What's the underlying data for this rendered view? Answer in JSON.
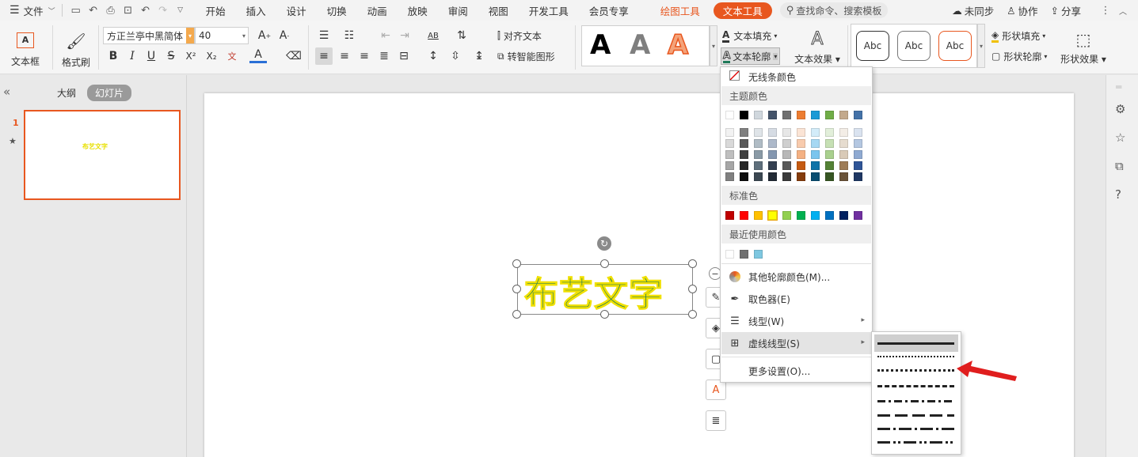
{
  "menubar": {
    "file_label": "文件",
    "tabs": [
      "开始",
      "插入",
      "设计",
      "切换",
      "动画",
      "放映",
      "审阅",
      "视图",
      "开发工具",
      "会员专享"
    ],
    "drawing_tools": "绘图工具",
    "text_tools": "文本工具",
    "search": "查找命令、搜索模板",
    "sync": "未同步",
    "collab": "协作",
    "share": "分享"
  },
  "ribbon": {
    "textbox": "文本框",
    "format_painter": "格式刷",
    "font_name": "方正兰亭中黑简体",
    "font_size": "40",
    "align_text": "对齐文本",
    "smart_shape": "转智能图形",
    "text_fill": "文本填充",
    "text_outline": "文本轮廓",
    "text_effect": "文本效果",
    "shape_fill": "形状填充",
    "shape_outline": "形状轮廓",
    "shape_effect": "形状效果",
    "style_sample": "A",
    "abc": [
      "Abc",
      "Abc",
      "Abc"
    ],
    "bold": "B",
    "italic": "I",
    "underline": "U",
    "strike": "S",
    "superscript": "X²",
    "subscript": "X₂",
    "font_color": "A",
    "ab": "AB"
  },
  "left_panel": {
    "outline_tab": "大纲",
    "slides_tab": "幻灯片",
    "slide_number": "1",
    "thumb_text": "布艺文字"
  },
  "slide": {
    "text": "布艺文字"
  },
  "dropdown": {
    "no_line": "无线条颜色",
    "theme_colors": "主题颜色",
    "standard_colors": "标准色",
    "recent_colors": "最近使用颜色",
    "more_colors": "其他轮廓颜色(M)...",
    "eyedropper": "取色器(E)",
    "line_type": "线型(W)",
    "dash_type": "虚线线型(S)",
    "more_settings": "更多设置(O)..."
  },
  "colors": {
    "theme_top": [
      "#ffffff",
      "#000000",
      "#d0d7dd",
      "#44546a",
      "#707070",
      "#ed7d31",
      "#1b9ad6",
      "#70ad47",
      "#c3a98c",
      "#4472a8"
    ],
    "theme_grid": [
      [
        "#f2f2f2",
        "#808080",
        "#dfe4e8",
        "#d6dce4",
        "#e7e7e7",
        "#fbe4d5",
        "#d3ecf9",
        "#e2efda",
        "#f3ede6",
        "#dae3f0"
      ],
      [
        "#d9d9d9",
        "#595959",
        "#b0bcc5",
        "#adb9ca",
        "#cfcfcf",
        "#f8cbad",
        "#a6d8f3",
        "#c6e0b4",
        "#e6dccf",
        "#b4c7e1"
      ],
      [
        "#bfbfbf",
        "#404040",
        "#8a9aa6",
        "#8497b0",
        "#b8b8b8",
        "#f4b183",
        "#7ac5ee",
        "#a9d08e",
        "#d9cab7",
        "#8faad2"
      ],
      [
        "#a6a6a6",
        "#262626",
        "#5e6f7c",
        "#333f50",
        "#595959",
        "#c55a11",
        "#0e73a8",
        "#548235",
        "#9e7c56",
        "#2f5597"
      ],
      [
        "#808080",
        "#0d0d0d",
        "#3c4852",
        "#222a35",
        "#3b3b3b",
        "#843c0c",
        "#094d70",
        "#375623",
        "#6a5339",
        "#1f3864"
      ]
    ],
    "standard": [
      "#c00000",
      "#ff0000",
      "#ffc000",
      "#ffff00",
      "#92d050",
      "#00b050",
      "#00b0f0",
      "#0070c0",
      "#002060",
      "#7030a0"
    ],
    "recent": [
      "#ffffff",
      "#707070",
      "#7ec7e0"
    ],
    "accent": "#e8571f",
    "slide_text": "#1f7a5a",
    "slide_text_outline": "#f0e000"
  }
}
